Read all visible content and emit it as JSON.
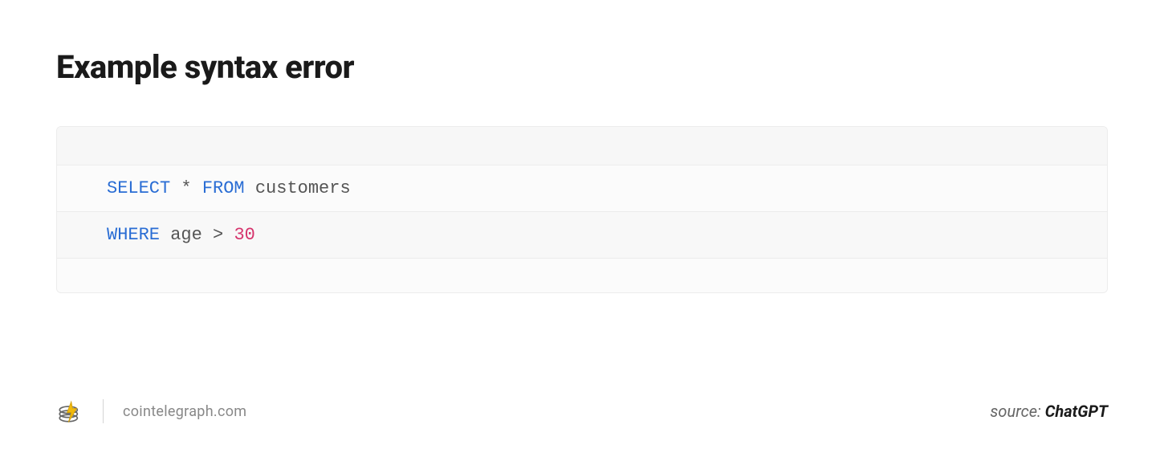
{
  "title": "Example syntax error",
  "code": {
    "line1": {
      "kw1": "SELECT",
      "mid": " * ",
      "kw2": "FROM",
      "rest": " customers"
    },
    "line2": {
      "kw1": "WHERE",
      "mid": " age > ",
      "num": "30"
    }
  },
  "footer": {
    "site": "cointelegraph.com",
    "source_label": "source: ",
    "source_name": "ChatGPT"
  }
}
